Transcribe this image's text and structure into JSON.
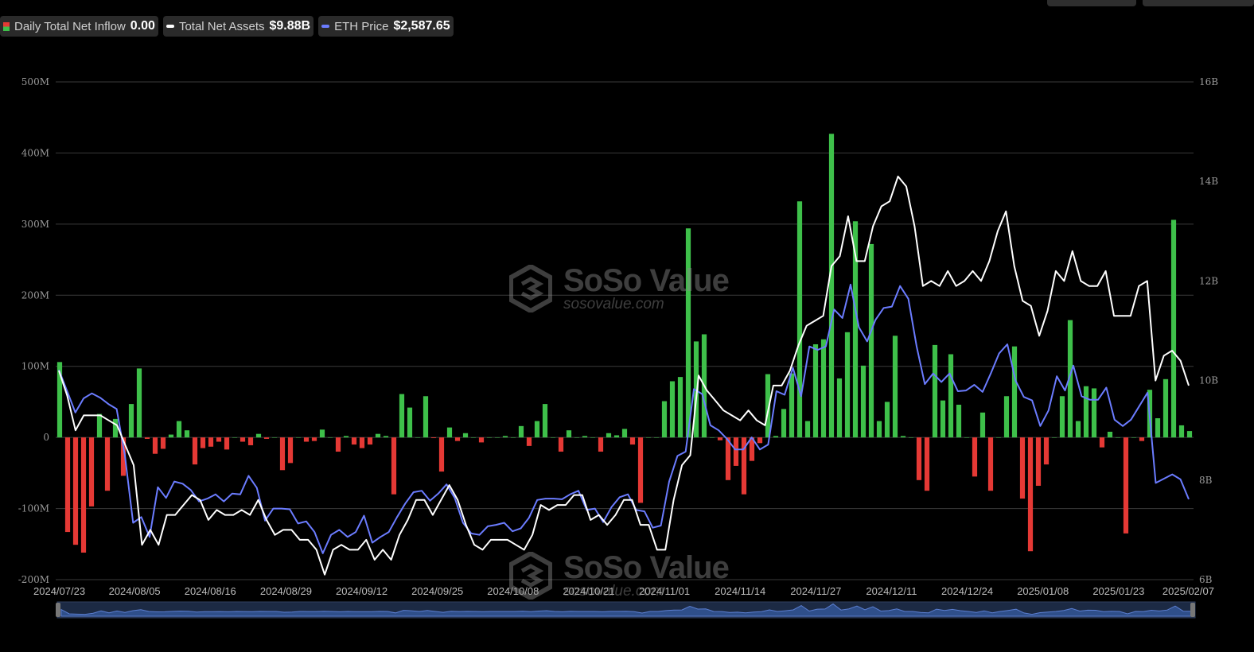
{
  "legend": [
    {
      "label": "Daily Total Net Inflow",
      "value": "0.00",
      "color_pos": "#3ec04a",
      "color_neg": "#e53935"
    },
    {
      "label": "Total Net Assets",
      "value": "$9.88B",
      "color": "#ffffff"
    },
    {
      "label": "ETH Price",
      "value": "$2,587.65",
      "color": "#6b7cff"
    }
  ],
  "watermark": {
    "brand": "SoSo Value",
    "url": "sosovalue.com"
  },
  "chart_data": {
    "type": "bar",
    "title": "",
    "x_tick_labels": [
      "2024/07/23",
      "2024/08/05",
      "2024/08/16",
      "2024/08/29",
      "2024/09/12",
      "2024/09/25",
      "2024/10/08",
      "2024/10/21",
      "2024/11/01",
      "2024/11/14",
      "2024/11/27",
      "2024/12/11",
      "2024/12/24",
      "2025/01/08",
      "2025/01/23",
      "2025/02/07"
    ],
    "y_left": {
      "ticks": [
        "-200M",
        "-100M",
        "0",
        "100M",
        "200M",
        "300M",
        "400M",
        "500M"
      ],
      "ylim": [
        -200,
        500
      ],
      "unit": "M"
    },
    "y_right": {
      "ticks": [
        "6B",
        "8B",
        "10B",
        "12B",
        "14B",
        "16B"
      ],
      "ylim": [
        6,
        16
      ],
      "unit": "B"
    },
    "grid": true,
    "series": [
      {
        "name": "Daily Total Net Inflow",
        "type": "bar",
        "unit": "M",
        "color_pos": "#3ec04a",
        "color_neg": "#e53935",
        "values": [
          106,
          -133,
          -151,
          -162,
          -97,
          33,
          -75,
          26,
          -54,
          47,
          97,
          -2,
          -23,
          -16,
          4,
          23,
          10,
          -38,
          -15,
          -13,
          -6,
          -17,
          0,
          -6,
          -11,
          5,
          -2,
          0,
          -46,
          -36,
          0,
          -6,
          -5,
          11,
          0,
          -20,
          2,
          -10,
          -15,
          -10,
          5,
          2,
          -80,
          61,
          42,
          0,
          58,
          -1,
          -48,
          14,
          -5,
          6,
          0,
          -7,
          0,
          0,
          2,
          0,
          16,
          -12,
          23,
          47,
          0,
          -20,
          10,
          0,
          2,
          0,
          -20,
          6,
          3,
          12,
          -10,
          -92,
          0,
          0,
          51,
          79,
          85,
          294,
          135,
          145,
          0,
          -4,
          -60,
          -40,
          -80,
          -33,
          -8,
          89,
          2,
          40,
          90,
          332,
          23,
          131,
          138,
          427,
          83,
          148,
          304,
          101,
          272,
          23,
          50,
          143,
          2,
          0,
          -60,
          -75,
          130,
          52,
          117,
          46,
          0,
          -55,
          35,
          -75,
          0,
          58,
          128,
          -86,
          -160,
          -68,
          -38,
          0,
          58,
          165,
          23,
          72,
          69,
          -14,
          8,
          0,
          -135,
          0,
          -5,
          67,
          27,
          82,
          306,
          17,
          9
        ]
      },
      {
        "name": "Total Net Assets",
        "type": "line",
        "unit": "B",
        "color": "#ffffff",
        "values": [
          10.2,
          9.7,
          9.0,
          9.3,
          9.3,
          9.3,
          9.2,
          9.1,
          8.7,
          8.3,
          6.7,
          7.0,
          6.7,
          7.3,
          7.3,
          7.5,
          7.7,
          7.6,
          7.2,
          7.4,
          7.3,
          7.3,
          7.4,
          7.3,
          7.6,
          7.2,
          6.9,
          7.0,
          7.0,
          6.8,
          6.8,
          6.6,
          6.1,
          6.6,
          6.7,
          6.6,
          6.6,
          6.8,
          6.4,
          6.6,
          6.4,
          6.9,
          7.2,
          7.6,
          7.6,
          7.3,
          7.6,
          7.9,
          7.6,
          7.1,
          6.7,
          6.6,
          6.8,
          6.8,
          6.8,
          6.7,
          6.6,
          6.9,
          7.5,
          7.4,
          7.5,
          7.5,
          7.7,
          7.7,
          7.2,
          7.3,
          7.1,
          7.3,
          7.6,
          7.6,
          7.1,
          7.1,
          6.6,
          6.6,
          7.6,
          8.3,
          8.5,
          10.1,
          9.8,
          9.6,
          9.4,
          9.3,
          9.2,
          9.4,
          9.2,
          9.1,
          9.9,
          9.9,
          10.2,
          10.7,
          11.1,
          11.2,
          11.3,
          12.3,
          12.5,
          13.3,
          12.4,
          12.4,
          13.1,
          13.5,
          13.6,
          14.1,
          13.9,
          13.1,
          11.9,
          12.0,
          11.9,
          12.2,
          11.9,
          12.0,
          12.2,
          12.0,
          12.4,
          13.0,
          13.4,
          12.3,
          11.6,
          11.5,
          10.9,
          11.4,
          12.2,
          12.0,
          12.6,
          12.0,
          11.9,
          11.9,
          12.2,
          11.3,
          11.3,
          11.3,
          11.9,
          12.0,
          10.0,
          10.5,
          10.6,
          10.4,
          9.9
        ]
      },
      {
        "name": "ETH Price",
        "type": "line",
        "unit": "$",
        "axis": "left-scaled",
        "color": "#6b7cff",
        "values": [
          95,
          65,
          35,
          55,
          62,
          56,
          47,
          40,
          -25,
          -120,
          -112,
          -140,
          -70,
          -85,
          -62,
          -65,
          -74,
          -90,
          -86,
          -80,
          -90,
          -79,
          -80,
          -54,
          -71,
          -117,
          -100,
          -100,
          -101,
          -121,
          -118,
          -133,
          -163,
          -137,
          -130,
          -140,
          -133,
          -110,
          -148,
          -140,
          -133,
          -112,
          -93,
          -77,
          -75,
          -89,
          -79,
          -66,
          -85,
          -120,
          -135,
          -137,
          -125,
          -123,
          -120,
          -132,
          -128,
          -113,
          -88,
          -86,
          -86,
          -87,
          -80,
          -75,
          -102,
          -100,
          -119,
          -98,
          -84,
          -80,
          -102,
          -104,
          -127,
          -124,
          -62,
          -26,
          -20,
          68,
          61,
          17,
          10,
          -2,
          -17,
          -17,
          0,
          -17,
          -10,
          65,
          60,
          98,
          58,
          128,
          123,
          128,
          180,
          168,
          215,
          155,
          135,
          165,
          182,
          184,
          213,
          195,
          128,
          75,
          90,
          78,
          90,
          65,
          66,
          74,
          64,
          90,
          118,
          131,
          80,
          57,
          52,
          16,
          38,
          86,
          66,
          101,
          58,
          53,
          53,
          70,
          25,
          16,
          25,
          44,
          63,
          -64,
          -58,
          -52,
          -59,
          -87
        ]
      }
    ]
  }
}
